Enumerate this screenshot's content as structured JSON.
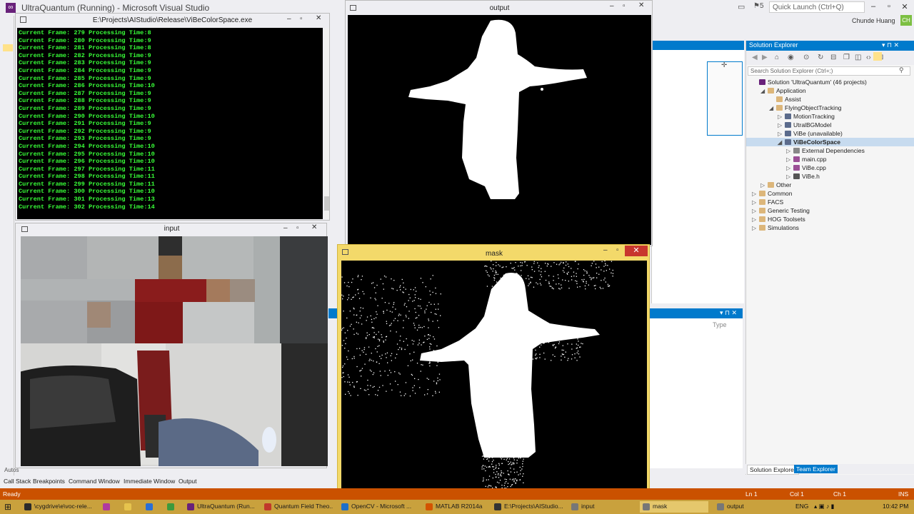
{
  "vs": {
    "title": "UltraQuantum (Running) - Microsoft Visual Studio",
    "quick_launch": "Quick Launch (Ctrl+Q)",
    "user": "Chunde Huang",
    "user_initials": "CH",
    "notif_count": "5"
  },
  "console": {
    "title": "E:\\Projects\\AIStudio\\Release\\ViBeColorSpace.exe",
    "lines": [
      "Current Frame: 279 Processing Time:8",
      "Current Frame: 280 Processing Time:9",
      "Current Frame: 281 Processing Time:8",
      "Current Frame: 282 Processing Time:9",
      "Current Frame: 283 Processing Time:9",
      "Current Frame: 284 Processing Time:9",
      "Current Frame: 285 Processing Time:9",
      "Current Frame: 286 Processing Time:10",
      "Current Frame: 287 Processing Time:9",
      "Current Frame: 288 Processing Time:9",
      "Current Frame: 289 Processing Time:9",
      "Current Frame: 290 Processing Time:10",
      "Current Frame: 291 Processing Time:9",
      "Current Frame: 292 Processing Time:9",
      "Current Frame: 293 Processing Time:9",
      "Current Frame: 294 Processing Time:10",
      "Current Frame: 295 Processing Time:10",
      "Current Frame: 296 Processing Time:10",
      "Current Frame: 297 Processing Time:11",
      "Current Frame: 298 Processing Time:11",
      "Current Frame: 299 Processing Time:11",
      "Current Frame: 300 Processing Time:10",
      "Current Frame: 301 Processing Time:13",
      "Current Frame: 302 Processing Time:14"
    ]
  },
  "windows": {
    "input_title": "input",
    "output_title": "output",
    "mask_title": "mask"
  },
  "solution": {
    "header": "Solution Explorer",
    "search": "Search Solution Explorer (Ctrl+;)",
    "tree": [
      {
        "label": "Solution 'UltraQuantum' (46 projects)",
        "depth": 0,
        "arrow": "",
        "icon": "#68217a"
      },
      {
        "label": "Application",
        "depth": 1,
        "arrow": "◢",
        "icon": "#dcb67a"
      },
      {
        "label": "Assist",
        "depth": 2,
        "arrow": "",
        "icon": "#dcb67a"
      },
      {
        "label": "FlyingObjectTracking",
        "depth": 2,
        "arrow": "◢",
        "icon": "#dcb67a"
      },
      {
        "label": "MotionTracking",
        "depth": 3,
        "arrow": "▷",
        "icon": "#5b6b8c"
      },
      {
        "label": "UtralBGModel",
        "depth": 3,
        "arrow": "▷",
        "icon": "#5b6b8c"
      },
      {
        "label": "ViBe (unavailable)",
        "depth": 3,
        "arrow": "▷",
        "icon": "#5b6b8c"
      },
      {
        "label": "ViBeColorSpace",
        "depth": 3,
        "arrow": "◢",
        "icon": "#5b6b8c",
        "selected": true
      },
      {
        "label": "External Dependencies",
        "depth": 4,
        "arrow": "▷",
        "icon": "#888"
      },
      {
        "label": "main.cpp",
        "depth": 4,
        "arrow": "▷",
        "icon": "#9b4f96"
      },
      {
        "label": "ViBe.cpp",
        "depth": 4,
        "arrow": "▷",
        "icon": "#9b4f96"
      },
      {
        "label": "ViBe.h",
        "depth": 4,
        "arrow": "▷",
        "icon": "#555"
      },
      {
        "label": "Other",
        "depth": 1,
        "arrow": "▷",
        "icon": "#dcb67a"
      },
      {
        "label": "Common",
        "depth": 0,
        "arrow": "▷",
        "icon": "#dcb67a"
      },
      {
        "label": "FACS",
        "depth": 0,
        "arrow": "▷",
        "icon": "#dcb67a"
      },
      {
        "label": "Generic Testing",
        "depth": 0,
        "arrow": "▷",
        "icon": "#dcb67a"
      },
      {
        "label": "HOG Toolsets",
        "depth": 0,
        "arrow": "▷",
        "icon": "#dcb67a"
      },
      {
        "label": "Simulations",
        "depth": 0,
        "arrow": "▷",
        "icon": "#dcb67a"
      }
    ],
    "tabs": [
      "Solution Explorer",
      "Team Explorer"
    ]
  },
  "locals": {
    "type_col": "Type"
  },
  "bottom_tabs": [
    "Call Stack",
    "Breakpoints",
    "Command Window",
    "Immediate Window",
    "Output"
  ],
  "status": {
    "ready": "Ready",
    "ln": "Ln 1",
    "col": "Col 1",
    "ch": "Ch 1",
    "mode": "INS"
  },
  "taskbar": {
    "items": [
      {
        "label": "\\cygdrive\\e\\voc-rele...",
        "color": "#2b2b2b"
      },
      {
        "label": "",
        "color": "#b03a9f"
      },
      {
        "label": "",
        "color": "#e6c34d"
      },
      {
        "label": "",
        "color": "#2a6fd6"
      },
      {
        "label": "",
        "color": "#3c9a3c"
      },
      {
        "label": "UltraQuantum (Run...",
        "color": "#68217a"
      },
      {
        "label": "Quantum Field Theo...",
        "color": "#c0392b"
      },
      {
        "label": "OpenCV - Microsoft ...",
        "color": "#1e6fc7"
      },
      {
        "label": "MATLAB R2014a",
        "color": "#d35400"
      },
      {
        "label": "E:\\Projects\\AIStudio...",
        "color": "#333"
      },
      {
        "label": "input",
        "color": "#777"
      },
      {
        "label": "mask",
        "color": "#777",
        "active": true
      },
      {
        "label": "output",
        "color": "#777"
      }
    ],
    "lang": "ENG",
    "time": "10:42 PM"
  },
  "colors": {
    "vs_blue": "#007acc",
    "status_orange": "#ca5100",
    "console_green": "#38ff38",
    "mask_frame": "#f3d96a"
  }
}
